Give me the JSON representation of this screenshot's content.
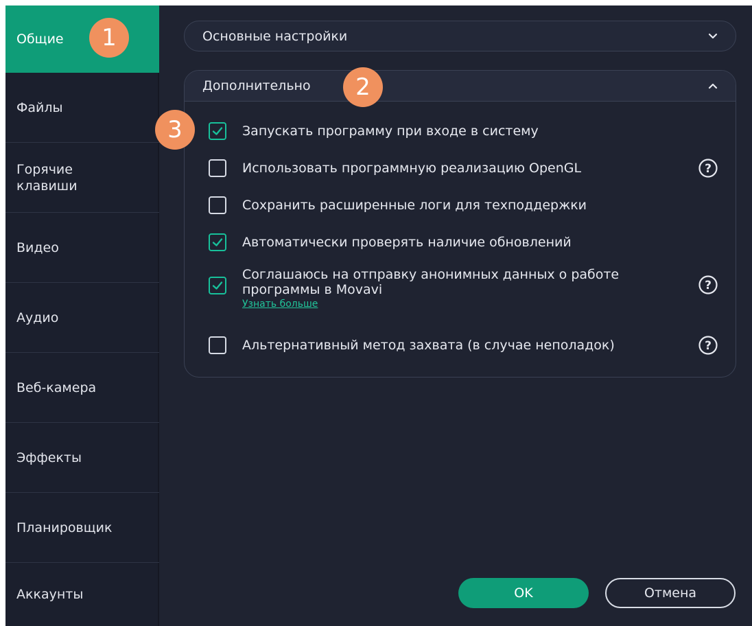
{
  "sidebar": {
    "items": [
      {
        "label": "Общие"
      },
      {
        "label": "Файлы"
      },
      {
        "label": "Горячие клавиши"
      },
      {
        "label": "Видео"
      },
      {
        "label": "Аудио"
      },
      {
        "label": "Веб-камера"
      },
      {
        "label": "Эффекты"
      },
      {
        "label": "Планировщик"
      },
      {
        "label": "Аккаунты"
      }
    ],
    "active": "Общие"
  },
  "panels": {
    "basic": {
      "title": "Основные настройки",
      "expanded": false,
      "icon": "chevron-down-icon"
    },
    "advanced": {
      "title": "Дополнительно",
      "expanded": true,
      "icon": "chevron-up-icon"
    }
  },
  "options": [
    {
      "label": "Запускать программу при входе в систему",
      "checked": true,
      "help": false
    },
    {
      "label": "Использовать программную реализацию OpenGL",
      "checked": false,
      "help": true
    },
    {
      "label": "Сохранить расширенные логи для техподдержки",
      "checked": false,
      "help": false
    },
    {
      "label": "Автоматически проверять наличие обновлений",
      "checked": true,
      "help": false
    },
    {
      "label": "Соглашаюсь на отправку анонимных данных о работе программы в Movavi",
      "checked": true,
      "help": true,
      "link": "Узнать больше"
    },
    {
      "label": "Альтернативный метод захвата (в случае неполадок)",
      "checked": false,
      "help": true
    }
  ],
  "buttons": {
    "ok": "OK",
    "cancel": "Отмена"
  },
  "badges": [
    "1",
    "2",
    "3"
  ],
  "colors": {
    "accent": "#0f9d78",
    "checkbox_check": "#18c09a",
    "link": "#21c59a",
    "background": "#1f2331",
    "badge": "#f0915e"
  }
}
